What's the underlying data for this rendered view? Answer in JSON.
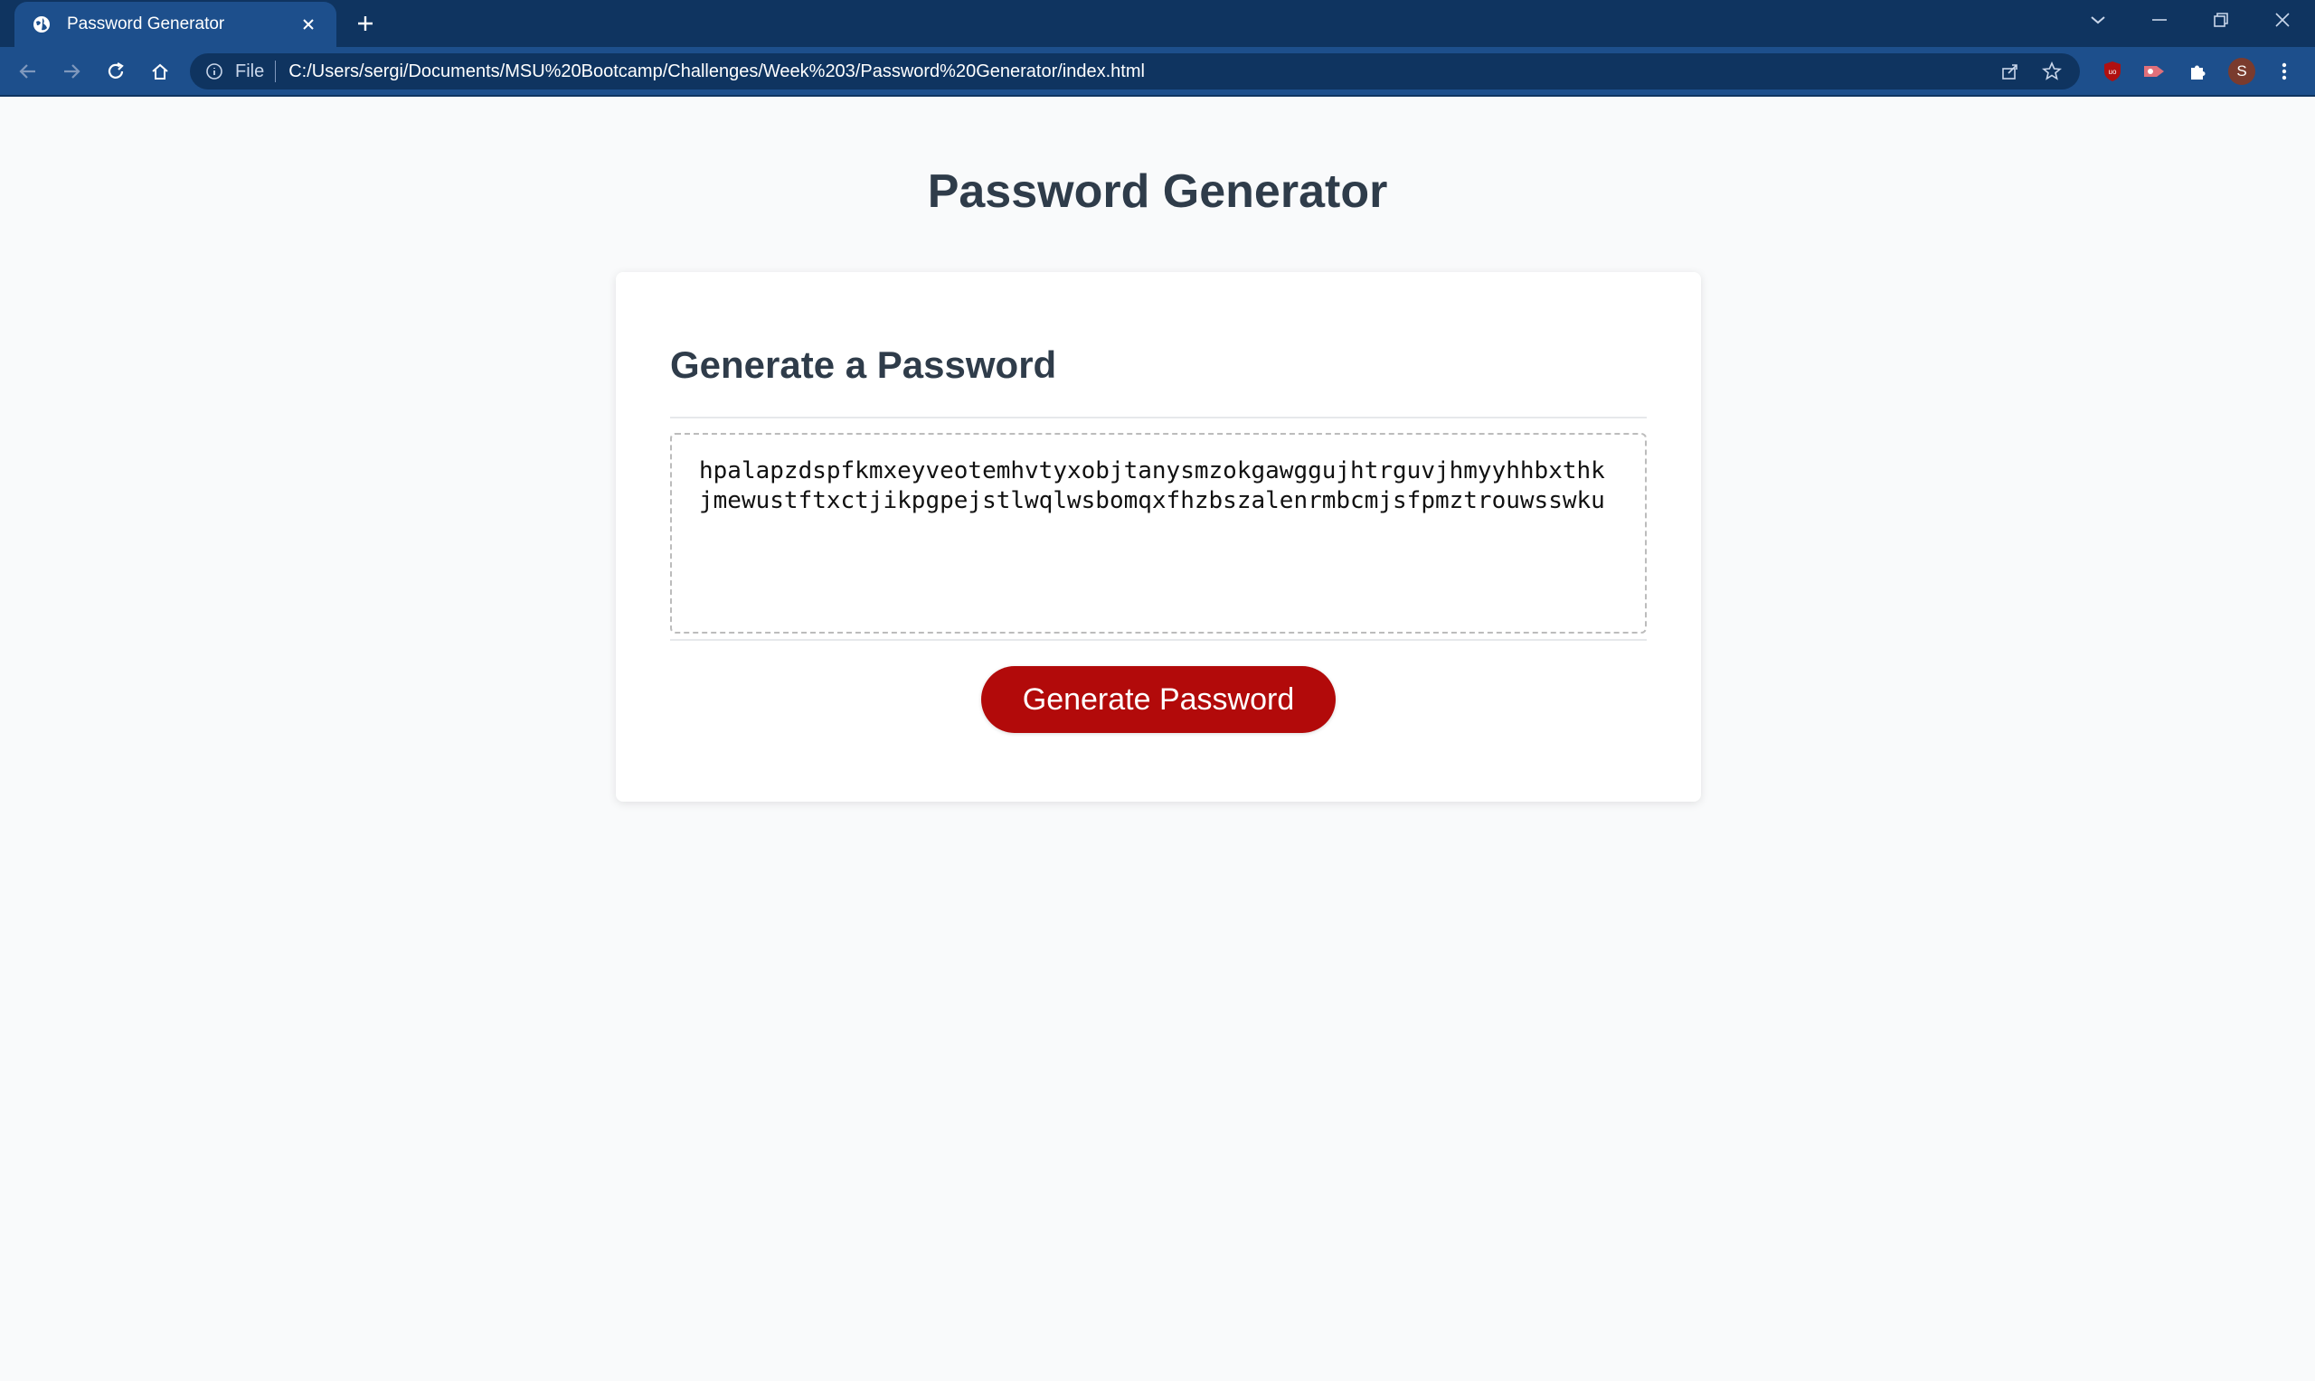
{
  "browser": {
    "tab_title": "Password Generator",
    "url_scheme": "File",
    "url": "C:/Users/sergi/Documents/MSU%20Bootcamp/Challenges/Week%203/Password%20Generator/index.html",
    "profile_initial": "S",
    "colors": {
      "tabstrip": "#0f3460",
      "toolbar": "#1d4f8c"
    }
  },
  "page": {
    "title": "Password Generator",
    "card": {
      "header": "Generate a Password",
      "password_value": "hpalapzdspfkmxeyveotemhvtyxobjtanysmzokgawggujhtrguvjhmyyhhbxthkjmewustftxctjikpgpejstlwqlwsbomqxfhzbszalenrmbcmjsfpmztrouwsswku",
      "button_label": "Generate Password"
    },
    "colors": {
      "button": "#b20a0a",
      "heading": "#2f3c4a",
      "background": "#f9fafb"
    }
  }
}
